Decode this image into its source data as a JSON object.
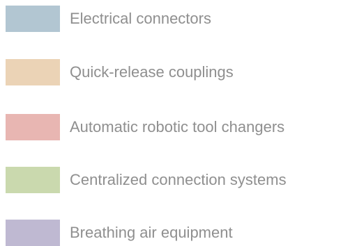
{
  "chart_data": {
    "type": "legend",
    "legend": {
      "items": [
        {
          "label": "Electrical connectors",
          "color": "#b2c6d2"
        },
        {
          "label": "Quick-release couplings",
          "color": "#ebd3b6"
        },
        {
          "label": "Automatic robotic tool changers",
          "color": "#e8b6b2"
        },
        {
          "label": "Centralized connection systems",
          "color": "#cad9ae"
        },
        {
          "label": "Breathing air equipment",
          "color": "#bfb9d2"
        }
      ]
    }
  }
}
